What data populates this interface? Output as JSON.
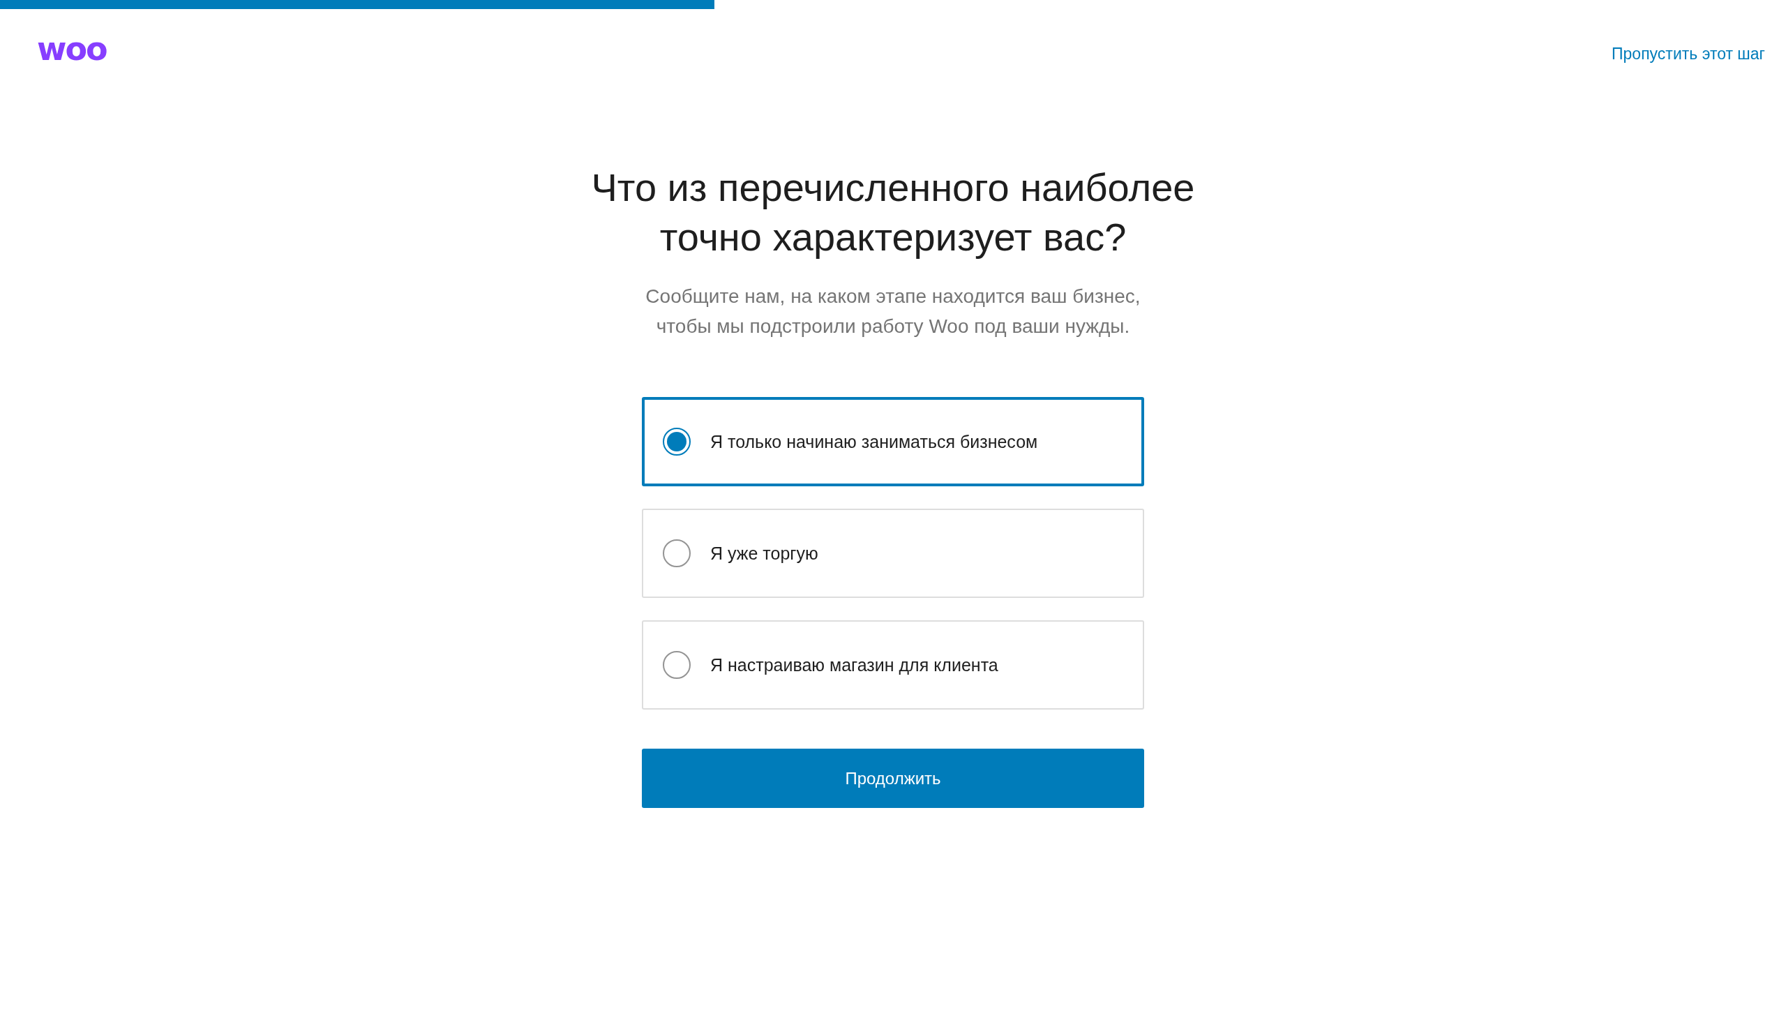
{
  "progress": {
    "level": 0.4
  },
  "header": {
    "logo": "woo",
    "skip_link": "Пропустить этот шаг"
  },
  "title": "Что из перечисленного наиболее точно характеризует вас?",
  "subtitle": "Сообщите нам, на каком этапе находится ваш бизнес, чтобы мы подстроили работу Woo под ваши нужды.",
  "options": [
    {
      "label": "Я только начинаю заниматься бизнесом",
      "selected": true
    },
    {
      "label": "Я уже торгую",
      "selected": false
    },
    {
      "label": "Я настраиваю магазин для клиента",
      "selected": false
    }
  ],
  "button": "Продолжить"
}
